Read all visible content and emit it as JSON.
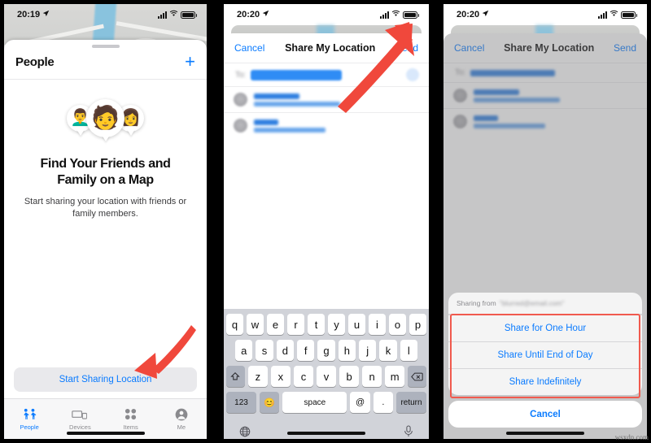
{
  "watermark": "wsxdn.com",
  "panel1": {
    "status": {
      "time": "20:19",
      "location_icon": "location-arrow-icon",
      "wifi_icon": "wifi-icon",
      "battery_icon": "battery-icon",
      "signal_icon": "cellular-bars-icon"
    },
    "sheet_title": "People",
    "add_button": "+",
    "headline_line1": "Find Your Friends and",
    "headline_line2": "Family on a Map",
    "subtext": "Start sharing your location with friends or family members.",
    "cta_label": "Start Sharing Location",
    "memoji": [
      "👨‍🦱",
      "🧑",
      "👩"
    ],
    "tabs": [
      {
        "label": "People",
        "icon": "people-icon",
        "active": true
      },
      {
        "label": "Devices",
        "icon": "devices-icon",
        "active": false
      },
      {
        "label": "Items",
        "icon": "items-icon",
        "active": false
      },
      {
        "label": "Me",
        "icon": "person-circle-icon",
        "active": false
      }
    ]
  },
  "panel2": {
    "status": {
      "time": "20:20"
    },
    "cancel_label": "Cancel",
    "title": "Share My Location",
    "send_label": "Send",
    "keyboard": {
      "row1": [
        "q",
        "w",
        "e",
        "r",
        "t",
        "y",
        "u",
        "i",
        "o",
        "p"
      ],
      "row2": [
        "a",
        "s",
        "d",
        "f",
        "g",
        "h",
        "j",
        "k",
        "l"
      ],
      "row3": [
        "z",
        "x",
        "c",
        "v",
        "b",
        "n",
        "m"
      ],
      "shift_icon": "shift-icon",
      "backspace_icon": "backspace-icon",
      "numbers_key": "123",
      "emoji_key": "😊",
      "space_key": "space",
      "at_key": "@",
      "period_key": ".",
      "return_key": "return",
      "globe_icon": "globe-icon",
      "mic_icon": "microphone-icon"
    }
  },
  "panel3": {
    "status": {
      "time": "20:20"
    },
    "cancel_label": "Cancel",
    "title": "Share My Location",
    "send_label": "Send",
    "sheet_header_prefix": "Sharing from",
    "sheet_header_email": "\"blurred@email.com\"",
    "options": [
      "Share for One Hour",
      "Share Until End of Day",
      "Share Indefinitely"
    ],
    "cancel_action": "Cancel",
    "highlight_color": "#f05a4e"
  },
  "annotations": {
    "arrow_color": "#f0483c",
    "arrow1_target": "start-sharing-location-button",
    "arrow2_target": "send-button"
  }
}
